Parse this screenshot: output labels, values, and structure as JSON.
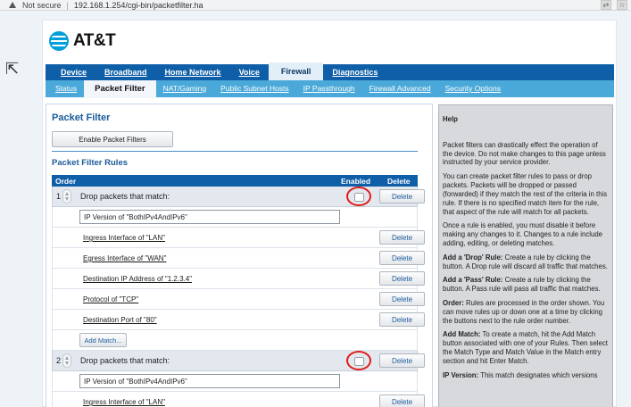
{
  "browser": {
    "security_label": "Not secure",
    "url": "192.168.1.254/cgi-bin/packetfilter.ha"
  },
  "brand": {
    "name": "AT&T",
    "color": "#009fdb"
  },
  "nav_primary": [
    {
      "label": "Device",
      "active": false
    },
    {
      "label": "Broadband",
      "active": false
    },
    {
      "label": "Home Network",
      "active": false
    },
    {
      "label": "Voice",
      "active": false
    },
    {
      "label": "Firewall",
      "active": true
    },
    {
      "label": "Diagnostics",
      "active": false
    }
  ],
  "nav_secondary": [
    {
      "label": "Status",
      "active": false
    },
    {
      "label": "Packet Filter",
      "active": true
    },
    {
      "label": "NAT/Gaming",
      "active": false
    },
    {
      "label": "Public Subnet Hosts",
      "active": false
    },
    {
      "label": "IP Passthrough",
      "active": false
    },
    {
      "label": "Firewall Advanced",
      "active": false
    },
    {
      "label": "Security Options",
      "active": false
    }
  ],
  "main": {
    "title": "Packet Filter",
    "enable_button": "Enable Packet Filters",
    "rules_title": "Packet Filter Rules",
    "columns": {
      "order": "Order",
      "enabled": "Enabled",
      "delete": "Delete"
    },
    "delete_label": "Delete",
    "add_match_label": "Add Match...",
    "rules": [
      {
        "order": "1",
        "label": "Drop packets that match:",
        "enabled": false,
        "fixed_match": "IP Version of \"BothIPv4AndIPv6\"",
        "matches": [
          "Ingress Interface of \"LAN\"",
          "Egress Interface of \"WAN\"",
          "Destination IP Address of \"1.2.3.4\"",
          "Protocol of \"TCP\"",
          "Destination Port of \"80\""
        ]
      },
      {
        "order": "2",
        "label": "Drop packets that match:",
        "enabled": false,
        "fixed_match": "IP Version of \"BothIPv4AndIPv6\"",
        "matches": [
          "Ingress Interface of \"LAN\""
        ]
      }
    ]
  },
  "help": {
    "title": "Help",
    "paragraphs": [
      {
        "lead": "",
        "text": "Packet filters can drastically effect the operation of the device. Do not make changes to this page unless instructed by your service provider."
      },
      {
        "lead": "",
        "text": "You can create packet filter rules to pass or drop packets. Packets will be dropped or passed (forwarded) if they match the rest of the criteria in this rule. If there is no specified match item for the rule, that aspect of the rule will match for all packets."
      },
      {
        "lead": "",
        "text": "Once a rule is enabled, you must disable it before making any changes to it. Changes to a rule include adding, editing, or deleting matches."
      },
      {
        "lead": "Add a 'Drop' Rule:",
        "text": " Create a rule by clicking the button. A Drop rule will discard all traffic that matches."
      },
      {
        "lead": "Add a 'Pass' Rule:",
        "text": " Create a rule by clicking the button. A Pass rule will pass all traffic that matches."
      },
      {
        "lead": "Order:",
        "text": " Rules are processed in the order shown. You can move rules up or down one at a time by clicking the buttons next to the rule order number."
      },
      {
        "lead": "Add Match:",
        "text": " To create a match, hit the Add Match button associated with one of your Rules. Then select the Match Type and Match Value in the Match entry section and hit Enter Match."
      },
      {
        "lead": "IP Version:",
        "text": " This match designates which versions"
      }
    ]
  },
  "colors": {
    "nav_primary_bg": "#0f5fa8",
    "nav_secondary_bg": "#4aa9d8",
    "highlight_circle": "#e01b1b"
  }
}
